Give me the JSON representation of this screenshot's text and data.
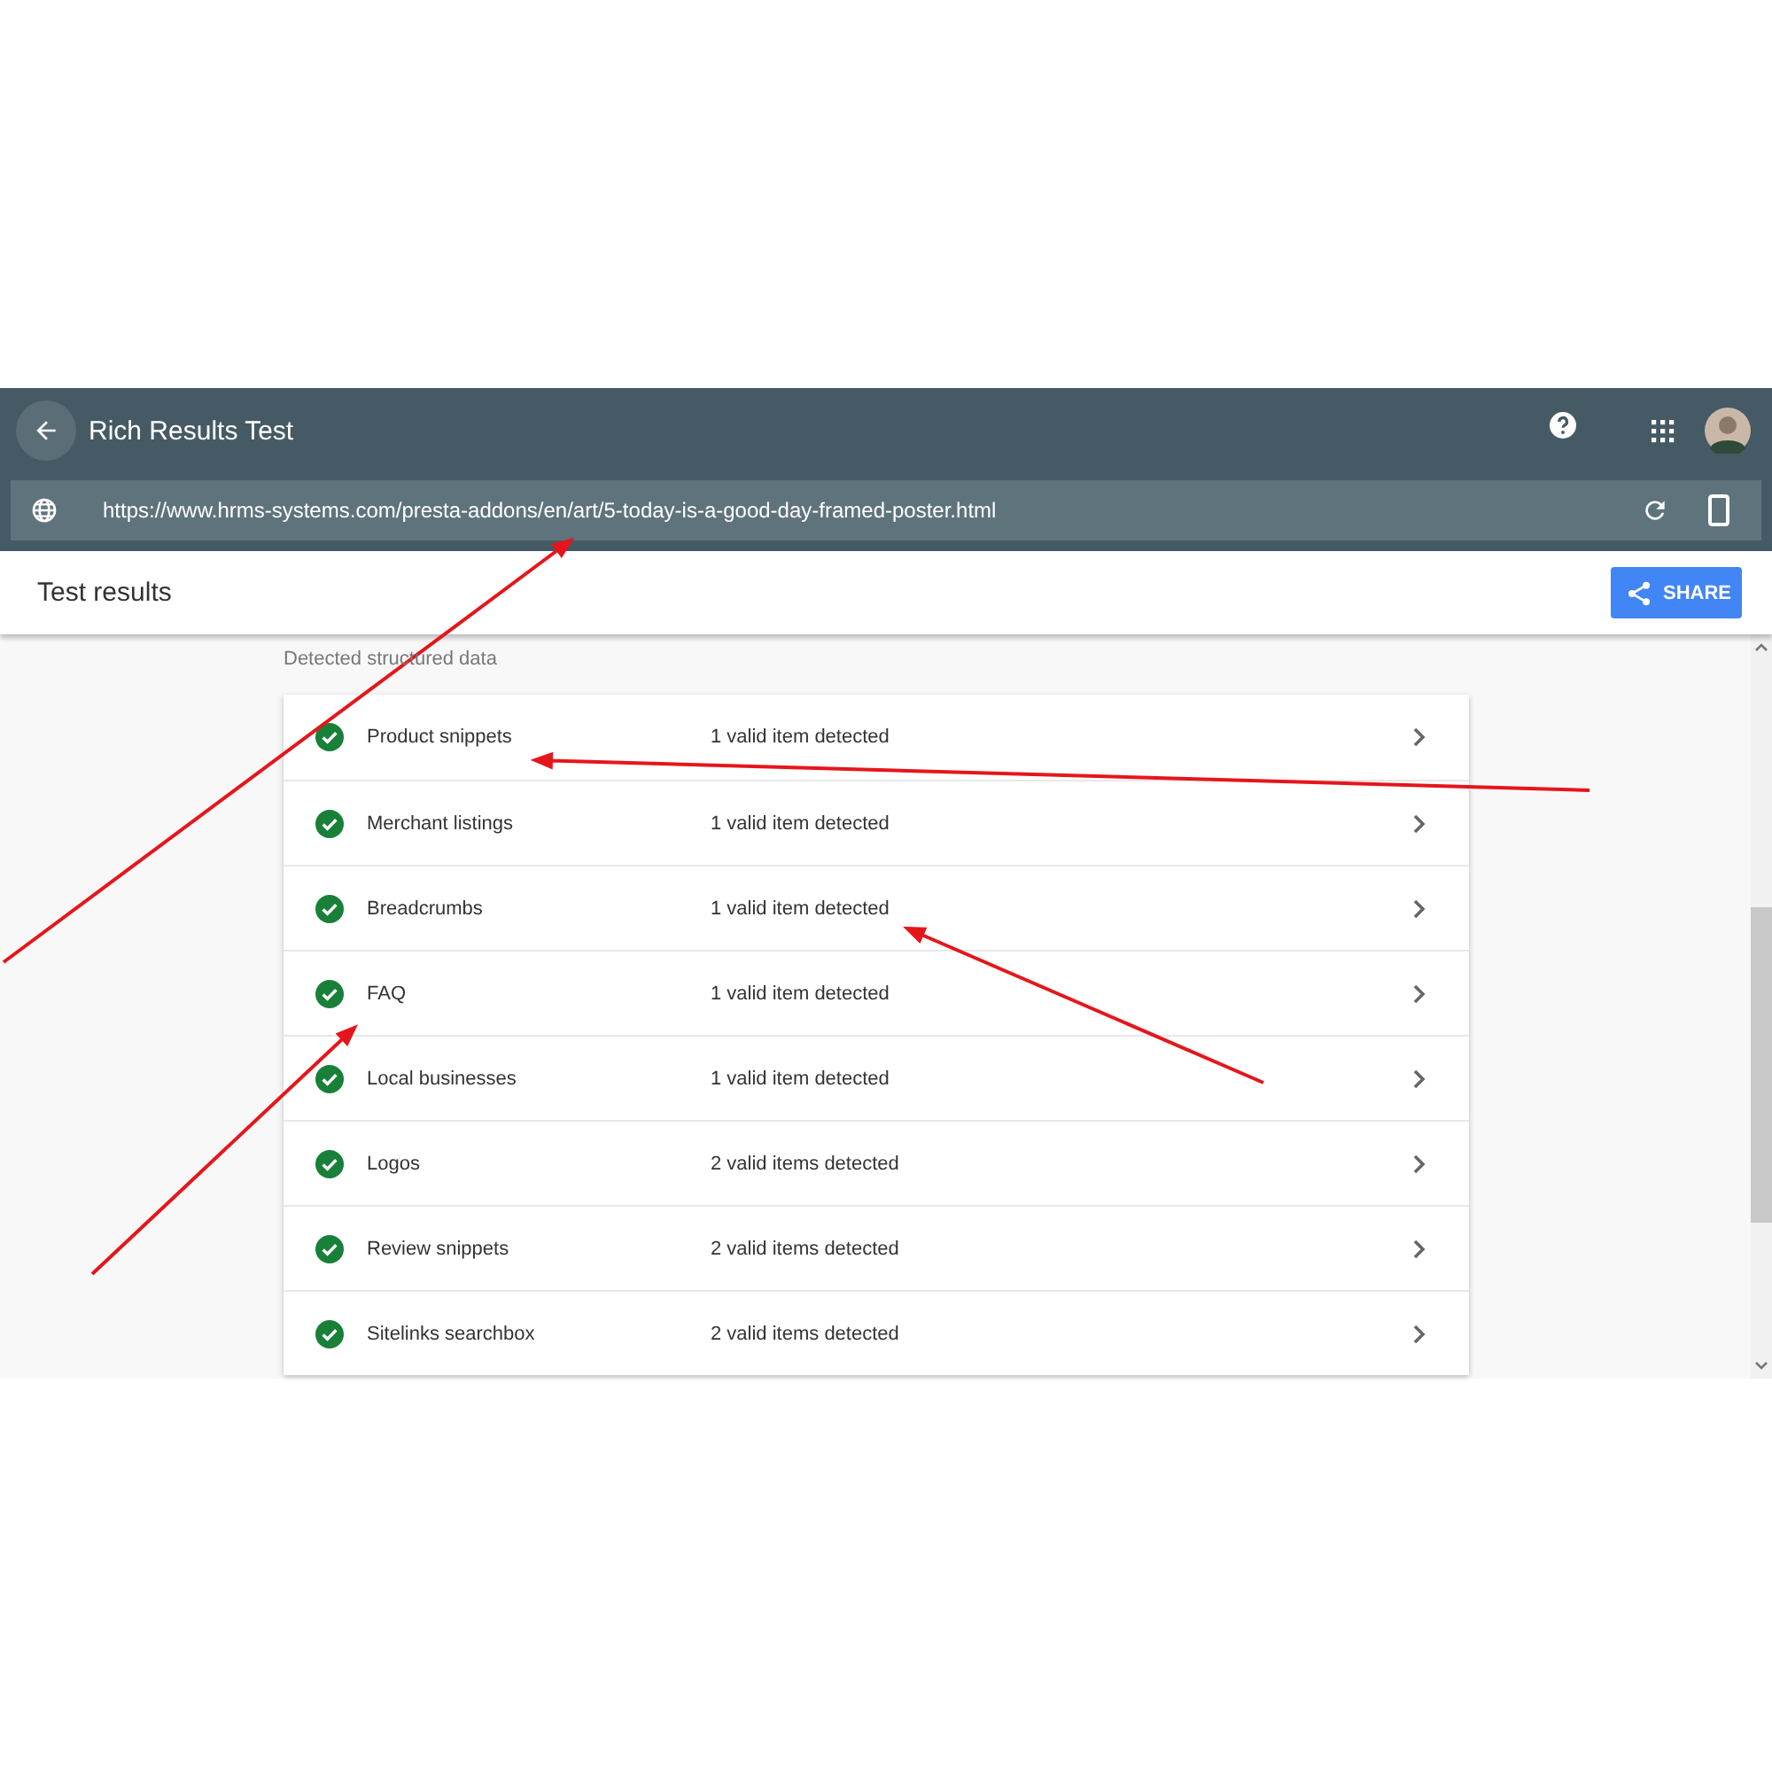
{
  "app_bar": {
    "title": "Rich Results Test"
  },
  "url_bar": {
    "value": "https://www.hrms-systems.com/presta-addons/en/art/5-today-is-a-good-day-framed-poster.html"
  },
  "results_bar": {
    "title": "Test results",
    "share_button": "SHARE"
  },
  "section_label": "Detected structured data",
  "results": [
    {
      "name": "Product snippets",
      "status": "1 valid item detected"
    },
    {
      "name": "Merchant listings",
      "status": "1 valid item detected"
    },
    {
      "name": "Breadcrumbs",
      "status": "1 valid item detected"
    },
    {
      "name": "FAQ",
      "status": "1 valid item detected"
    },
    {
      "name": "Local businesses",
      "status": "1 valid item detected"
    },
    {
      "name": "Logos",
      "status": "2 valid items detected"
    },
    {
      "name": "Review snippets",
      "status": "2 valid items detected"
    },
    {
      "name": "Sitelinks searchbox",
      "status": "2 valid items detected"
    }
  ]
}
